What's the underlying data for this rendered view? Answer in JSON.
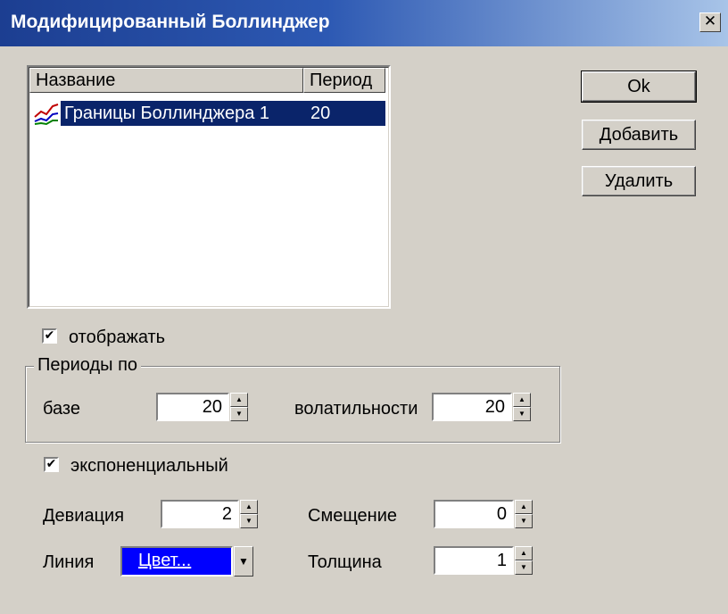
{
  "window": {
    "title": "Модифицированный Боллинджер",
    "close_glyph": "✕"
  },
  "list": {
    "columns": [
      "Название",
      "Период"
    ],
    "rows": [
      {
        "icon": "chart-line-icon",
        "name": "Границы Боллинджера 1",
        "period": "20"
      }
    ]
  },
  "buttons": {
    "ok": "Ok",
    "add": "Добавить",
    "delete": "Удалить"
  },
  "display": {
    "label": "отображать",
    "checked": true
  },
  "periods": {
    "group_title": "Периоды по",
    "base_label": "базе",
    "base_value": "20",
    "volatility_label": "волатильности",
    "volatility_value": "20"
  },
  "exponential": {
    "label": "экспоненциальный",
    "checked": true
  },
  "deviation": {
    "label": "Девиация",
    "value": "2"
  },
  "shift": {
    "label": "Смещение",
    "value": "0"
  },
  "line": {
    "label": "Линия",
    "color_button": "Цвет...",
    "color": "#0000ff"
  },
  "thickness": {
    "label": "Толщина",
    "value": "1"
  },
  "glyphs": {
    "check": "✔",
    "up": "▲",
    "down": "▼"
  }
}
